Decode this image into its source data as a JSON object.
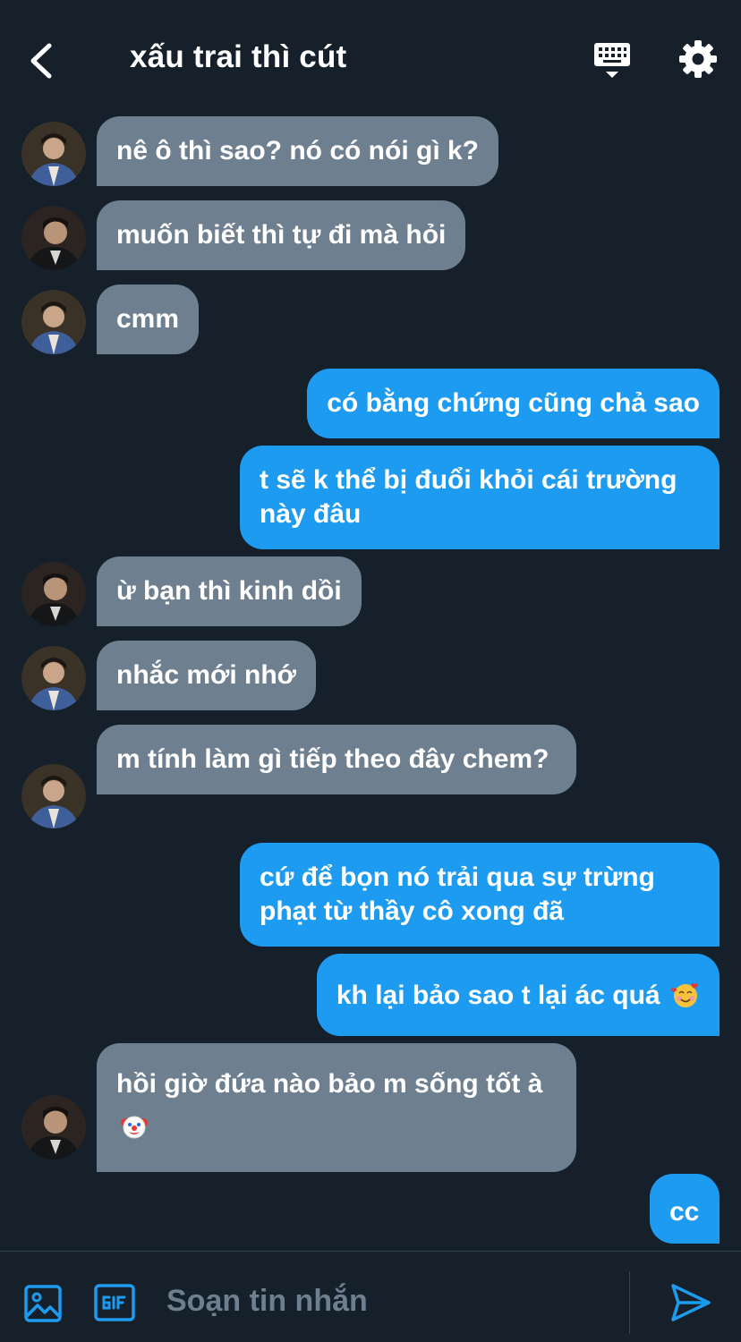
{
  "header": {
    "title": "xấu trai thì cút"
  },
  "messages": [
    {
      "side": "in",
      "text": "nê ô thì sao? nó có nói gì k?"
    },
    {
      "side": "in",
      "text": "muốn biết thì tự đi mà hỏi"
    },
    {
      "side": "in",
      "text": "cmm"
    },
    {
      "side": "out",
      "text": "có bằng chứng cũng chả sao"
    },
    {
      "side": "out",
      "text": "t sẽ k thể bị đuổi khỏi cái trường này đâu"
    },
    {
      "side": "in",
      "text": "ừ bạn thì kinh dồi"
    },
    {
      "side": "in",
      "text": "nhắc mới nhớ"
    },
    {
      "side": "in",
      "text": "m tính làm gì tiếp theo đây chem?"
    },
    {
      "side": "out",
      "text": "cứ để bọn nó trải qua sự trừng phạt từ thầy cô xong đã"
    },
    {
      "side": "out",
      "text": "kh lại bảo sao t lại ác quá",
      "emoji": "smiling-face-with-hearts"
    },
    {
      "side": "in",
      "text": "hồi giờ đứa nào bảo m sống tốt à",
      "emoji": "clown-face"
    },
    {
      "side": "out",
      "text": "cc"
    }
  ],
  "composer": {
    "placeholder": "Soạn tin nhắn"
  },
  "colors": {
    "background": "#15202b",
    "incoming_bubble": "#6e7f8f",
    "outgoing_bubble": "#1d9bf0",
    "accent": "#1d9bf0"
  },
  "icons": {
    "back": "chevron-left-icon",
    "keyboard": "keyboard-icon",
    "settings": "gear-icon",
    "image": "image-icon",
    "gif": "gif-icon",
    "send": "send-icon"
  }
}
